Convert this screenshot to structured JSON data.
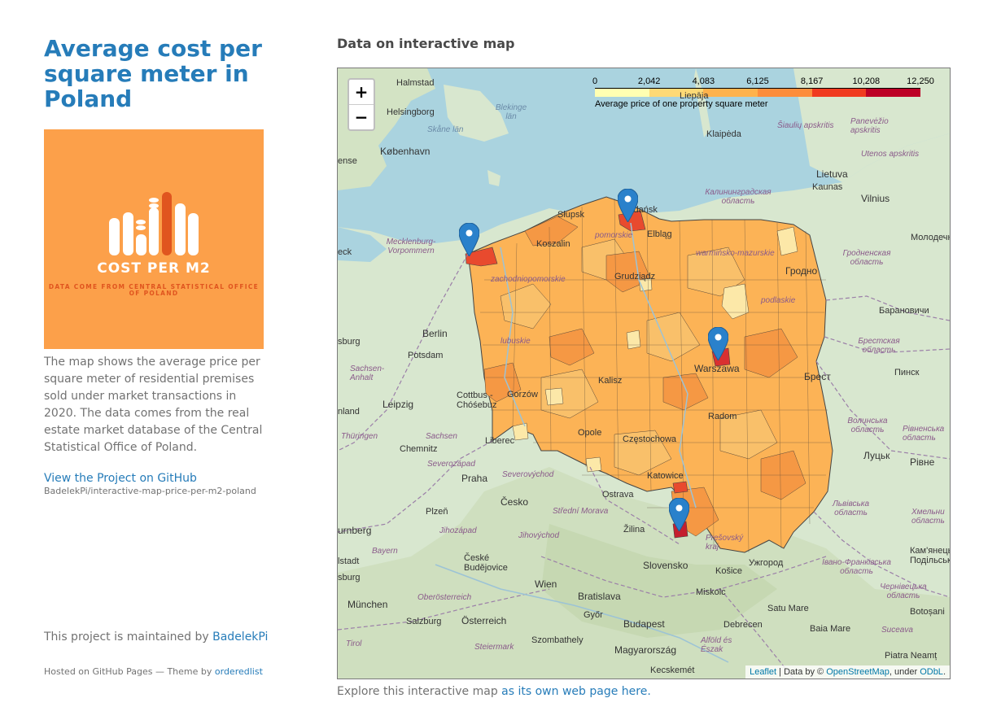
{
  "sidebar": {
    "title": "Average cost per square meter in Poland",
    "logo": {
      "title": "COST PER M2",
      "subtitle": "DATA COME FROM CENTRAL STATISTICAL OFFICE OF POLAND"
    },
    "description": "The map shows the average price per square meter of residential premises sold under market transactions in 2020. The data comes from the real estate market database of the Central Statistical Office of Poland.",
    "github_link": "View the Project on GitHub",
    "github_repo": "BadelekPi/interactive-map-price-per-m2-poland",
    "maintained_prefix": "This project is maintained by ",
    "maintainer": "BadelekPi",
    "hosted_prefix": "Hosted on GitHub Pages — Theme by ",
    "theme": "orderedlist"
  },
  "main": {
    "heading": "Data on interactive map",
    "caption_prefix": "Explore this interactive map ",
    "caption_link": "as its own web page here."
  },
  "map": {
    "zoom_in": "+",
    "zoom_out": "−",
    "legend": {
      "ticks": [
        "0",
        "2,042",
        "4,083",
        "6,125",
        "8,167",
        "10,208",
        "12,250"
      ],
      "caption": "Average price of one property square meter",
      "colors": [
        "#FFFFB2",
        "#FED976",
        "#FEB24C",
        "#FD8D3C",
        "#F03B20",
        "#BD0026"
      ]
    },
    "attribution": {
      "leaflet": "Leaflet",
      "data_by": " | Data by © ",
      "osm": "OpenStreetMap",
      "under": ", under ",
      "odbl": "ODbL",
      "end": "."
    },
    "places": {
      "halmstad": "Halmstad",
      "helsingborg": "Helsingborg",
      "kobenhavn": "København",
      "blekinge": "Blekinge län",
      "skane": "Skåne län",
      "klaipeda": "Klaipėda",
      "siauliu": "Šiaulių apskritis",
      "panevezio": "Panevėžio apskritis",
      "utenos": "Utenos apskritis",
      "lietuva": "Lietuva",
      "kaunas": "Kaunas",
      "vilnius": "Vilnius",
      "kalin_obl": "Калининградская область",
      "molodechno": "Молодечн",
      "grodno_obl": "Гродненская область",
      "grodno": "Гродно",
      "baranovichi": "Барановичи",
      "brest_obl": "Брестская область",
      "brest": "Брест",
      "pinsk": "Пинск",
      "volyn": "Волинська область",
      "rivne_obl": "Рівненська область",
      "lutsk": "Луцьк",
      "rivne": "Рівне",
      "lviv_obl": "Львівська область",
      "khmel": "Хмельни область",
      "kamianets": "Кам'янець-Подільський",
      "uzhhorod": "Ужгород",
      "if_obl": "Івано-Франківська область",
      "cherniv_obl": "Чернівецька область",
      "botosani": "Botoșani",
      "suceava": "Suceava",
      "satu_mare": "Satu Mare",
      "baia_mare": "Baia Mare",
      "piatra": "Piatra Neamț",
      "mecklenburg": "Mecklenburg-Vorpommern",
      "berlin": "Berlin",
      "potsdam": "Potsdam",
      "sachsen_anhalt": "Sachsen-Anhalt",
      "leipzig": "Leipzig",
      "cottbus": "Cottbus - Chóśebuz",
      "sachsen": "Sachsen",
      "thuringen": "Thüringen",
      "chemnitz": "Chemnitz",
      "liberec": "Liberec",
      "severozapad": "Severozápad",
      "praha": "Praha",
      "severovychod": "Severovýchod",
      "cesko": "Česko",
      "plzen": "Plzeň",
      "jihozapad": "Jihozápad",
      "stredni_morava": "Střední Morava",
      "jihovychod": "Jihovýchod",
      "ostrava": "Ostrava",
      "zilina": "Žilina",
      "bayern": "Bayern",
      "nurnberg": "urnberg",
      "ceske_budejovice": "České Budějovice",
      "wien": "Wien",
      "bratislava": "Bratislava",
      "slovensko": "Slovensko",
      "kosice": "Košice",
      "presov": "Prešovský kraj",
      "miskolc": "Miskolc",
      "munchen": "München",
      "oberosterreich": "Oberösterreich",
      "salzburg": "Salzburg",
      "osterreich": "Österreich",
      "gyor": "Győr",
      "budapest": "Budapest",
      "debrecen": "Debrecen",
      "steiermark": "Steiermark",
      "szombathely": "Szombathely",
      "magyarorszag": "Magyarország",
      "alfold": "Alföld és Észak",
      "kecskemet": "Kecskemét",
      "tirol": "Tirol",
      "slupsk": "Słupsk",
      "koszalin": "Koszalin",
      "elblag": "Elbląg",
      "grudziadz": "Grudziądz",
      "warszawa": "Warszawa",
      "kalisz": "Kalisz",
      "radom": "Radom",
      "opole": "Opole",
      "katowice": "Katowice",
      "czestochowa": "Częstochowa",
      "gorzow": "Gorzów",
      "lepaja": "Liepāja",
      "pomorze": "pomorskie",
      "zachodniopom": "zachodniopomorskie",
      "warminsko": "warmińsko-mazurskie",
      "podlaskie": "podlaskie",
      "lubuskie": "lubuskie",
      "gdansk": "Gdańsk",
      "sund": "ense",
      "eck": "eck",
      "sburg": "sburg",
      "nland": "nland",
      "lstadt": "lstadt",
      "sburg2": "sburg"
    }
  }
}
